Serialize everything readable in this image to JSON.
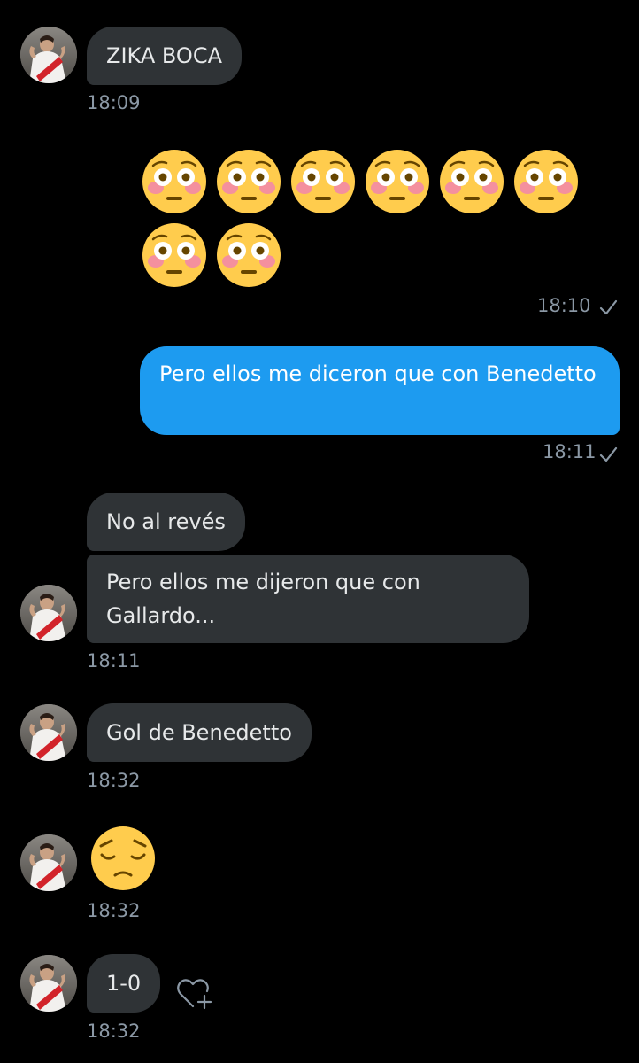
{
  "messages": [
    {
      "type": "text",
      "sender": "other",
      "text": "ZIKA BOCA",
      "time": "18:09"
    },
    {
      "type": "emoji",
      "sender": "me",
      "emoji": "flushed-face",
      "count": 8,
      "time": "18:10",
      "status": "sent-check"
    },
    {
      "type": "text",
      "sender": "me",
      "text": "Pero ellos me diceron que con Benedetto",
      "time": "18:11",
      "status": "sent-check"
    },
    {
      "type": "text",
      "sender": "other",
      "text": "No al revés"
    },
    {
      "type": "text",
      "sender": "other",
      "text": "Pero ellos me dijeron que con Gallardo...",
      "time": "18:11"
    },
    {
      "type": "text",
      "sender": "other",
      "text": "Gol de Benedetto",
      "time": "18:32"
    },
    {
      "type": "emoji",
      "sender": "other",
      "emoji": "pensive-face",
      "count": 1,
      "time": "18:32"
    },
    {
      "type": "text",
      "sender": "other",
      "text": "1-0",
      "time": "18:32",
      "action": "add-reaction-icon"
    }
  ],
  "colors": {
    "background": "#000000",
    "incoming_bubble": "#2f3336",
    "outgoing_bubble": "#1d9bf0",
    "timestamp": "#8b98a5",
    "text": "#e7e9ea"
  }
}
